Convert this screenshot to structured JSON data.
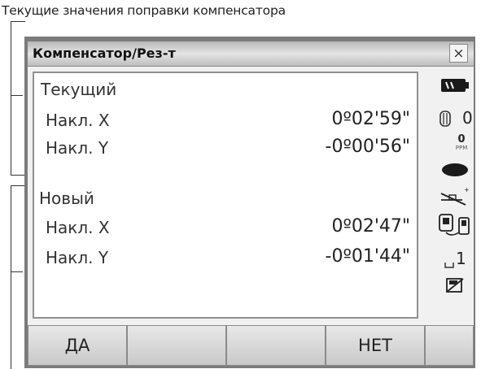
{
  "caption": "Текущие значения поправки компенсатора",
  "window": {
    "title": "Компенсатор/Рез-т",
    "close_glyph": "×"
  },
  "current": {
    "heading": "Текущий",
    "tilt_x_label": "Накл. X",
    "tilt_x_value": "0º02'59\"",
    "tilt_y_label": "Накл. Y",
    "tilt_y_value": "-0º00'56\""
  },
  "new": {
    "heading": "Новый",
    "tilt_x_label": "Накл. X",
    "tilt_x_value": "0º02'47\"",
    "tilt_y_label": "Накл. Y",
    "tilt_y_value": "-0º01'44\""
  },
  "status": {
    "prism_constant": "0",
    "ppm_value": "0",
    "ppm_unit": "PPM",
    "page_number": "1",
    "icons": [
      "battery-icon",
      "target-prism-icon",
      "ppm-icon",
      "laser-icon",
      "tilt-icon",
      "communication-icon",
      "input-mode-icon",
      "disk-icon"
    ],
    "accent_color": "#1a1a1a"
  },
  "softkeys": [
    "ДА",
    "",
    "",
    "НЕТ",
    ""
  ]
}
